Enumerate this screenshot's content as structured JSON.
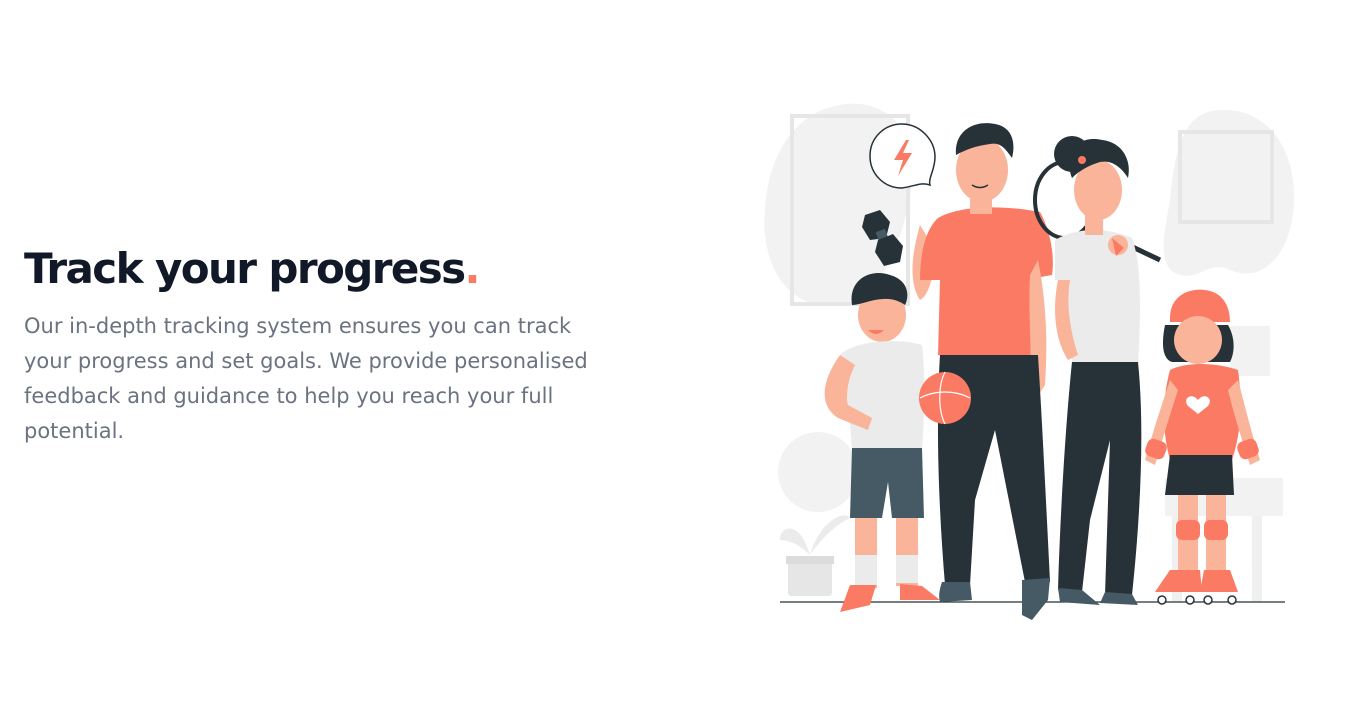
{
  "hero": {
    "title": "Track your progress",
    "title_punctuation": ".",
    "description": "Our in-depth tracking system ensures you can track your progress and set goals. We provide personalised feedback and guidance to help you reach your full potential."
  },
  "illustration": {
    "subject": "family-fitness-illustration",
    "icon": "lightning-icon"
  },
  "colors": {
    "accent": "#fa7a63",
    "heading": "#111827",
    "body_text": "#6b7280",
    "dark_clothing": "#263238",
    "background_shapes": "#f2f2f2"
  }
}
